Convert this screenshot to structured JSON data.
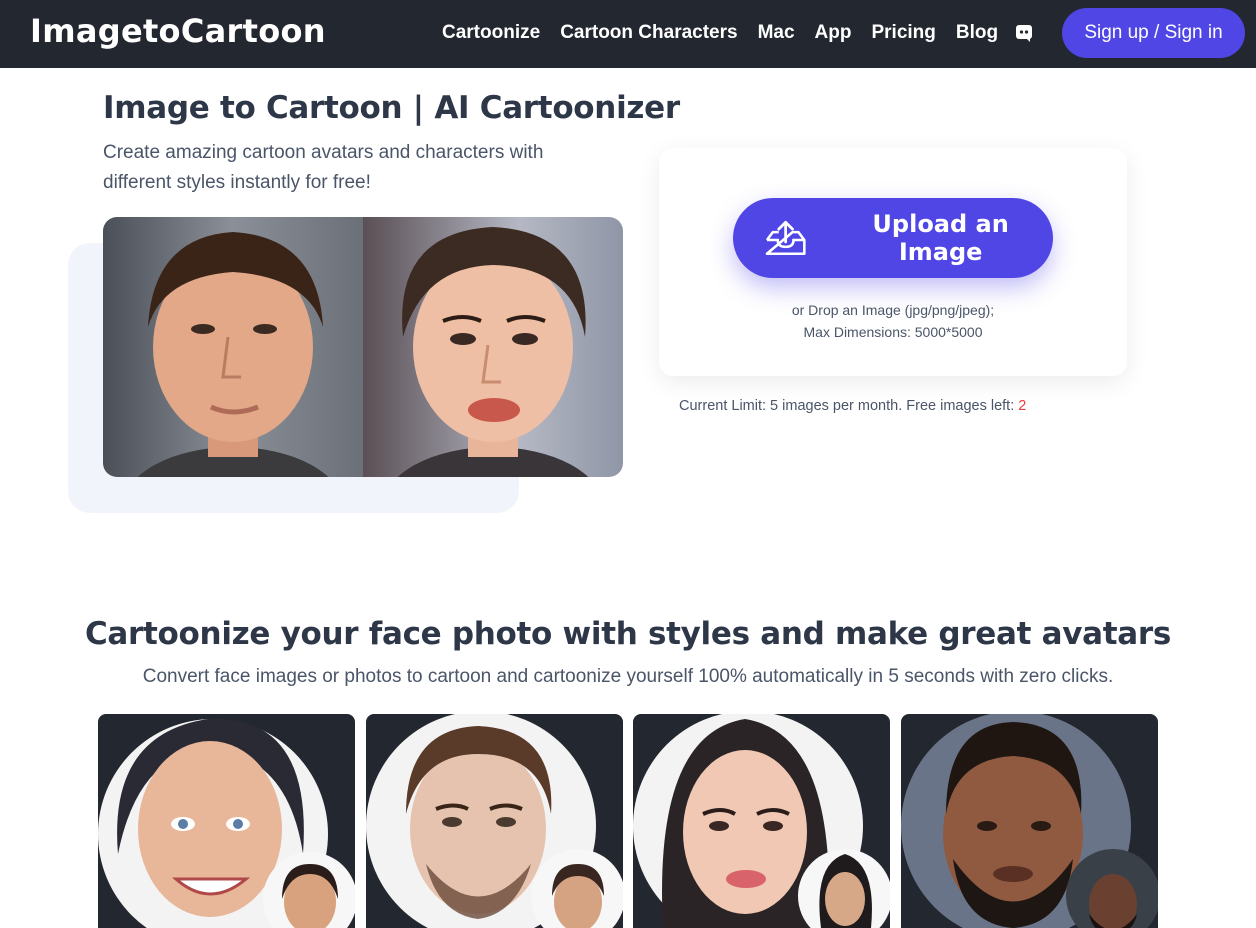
{
  "header": {
    "logo": "ImagetoCartoon",
    "nav": [
      "Cartoonize",
      "Cartoon Characters",
      "Mac",
      "App",
      "Pricing",
      "Blog"
    ],
    "discord_icon": "discord-icon",
    "signin_label": "Sign up / Sign in"
  },
  "hero": {
    "title": "Image to Cartoon | AI Cartoonizer",
    "subtitle": "Create amazing cartoon avatars and characters with different styles instantly for free!"
  },
  "upload": {
    "button_label": "Upload an Image",
    "icon": "upload-tray-icon",
    "drop_line1": "or Drop an Image (jpg/png/jpeg);",
    "drop_line2": "Max Dimensions: 5000*5000",
    "limit_text": "Current Limit: 5 images per month. Free images left:",
    "free_left": "2"
  },
  "section": {
    "title": "Cartoonize your face photo with styles and make great avatars",
    "subtitle": "Convert face images or photos to cartoon and cartoonize yourself 100% automatically in 5 seconds with zero clicks."
  },
  "colors": {
    "header_bg": "#23272f",
    "accent": "#4f46e5",
    "text_dark": "#2d3748",
    "text_muted": "#4a5568",
    "highlight_red": "#e53e3e"
  }
}
